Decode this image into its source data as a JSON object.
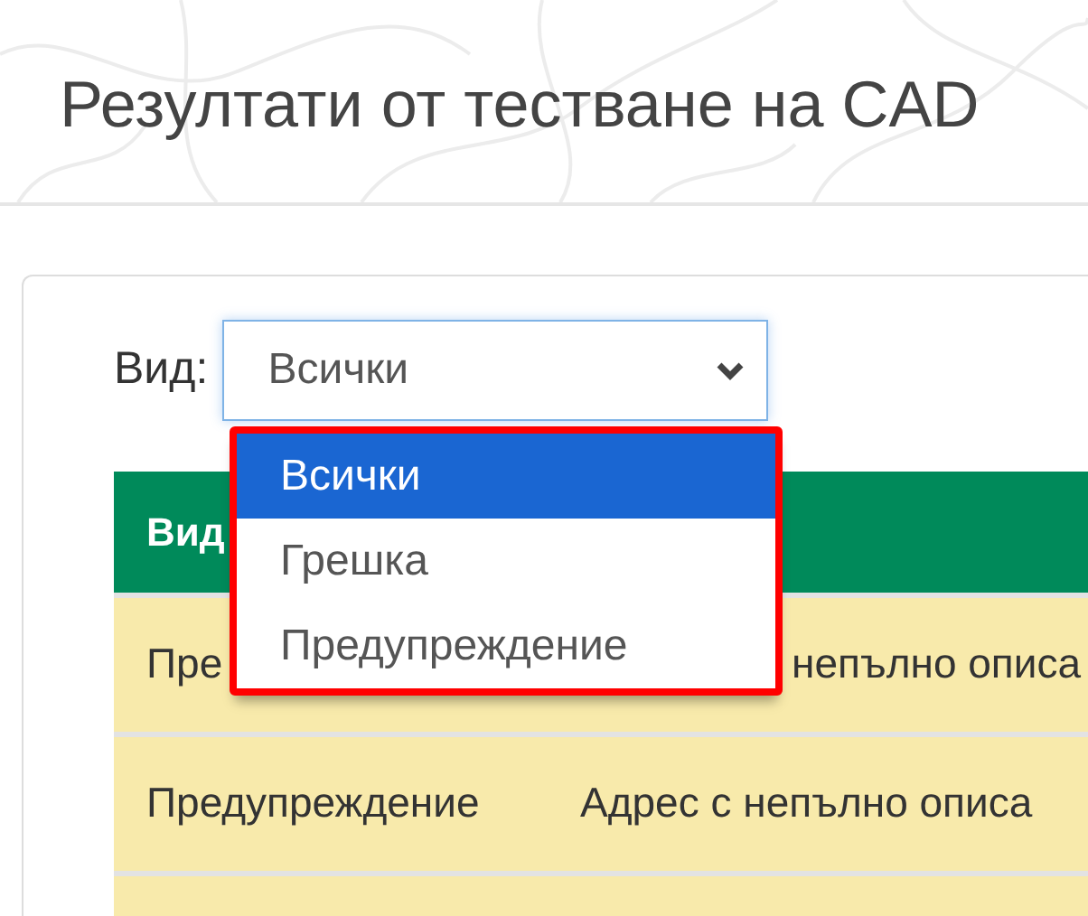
{
  "page": {
    "title": "Резултати от тестване на CAD"
  },
  "filter": {
    "label": "Вид:",
    "value": "Всички",
    "open": true,
    "options": [
      {
        "label": "Всички",
        "selected": true
      },
      {
        "label": "Грешка",
        "selected": false
      },
      {
        "label": "Предупреждение",
        "selected": false
      }
    ]
  },
  "table": {
    "columns": [
      "Вид"
    ],
    "rows": [
      {
        "kind": "warning",
        "cells": [
          "Пре",
          "непълно описа"
        ]
      },
      {
        "kind": "warning",
        "cells": [
          "Предупреждение",
          "Адрес с непълно описа"
        ]
      },
      {
        "kind": "warning"
      }
    ]
  }
}
